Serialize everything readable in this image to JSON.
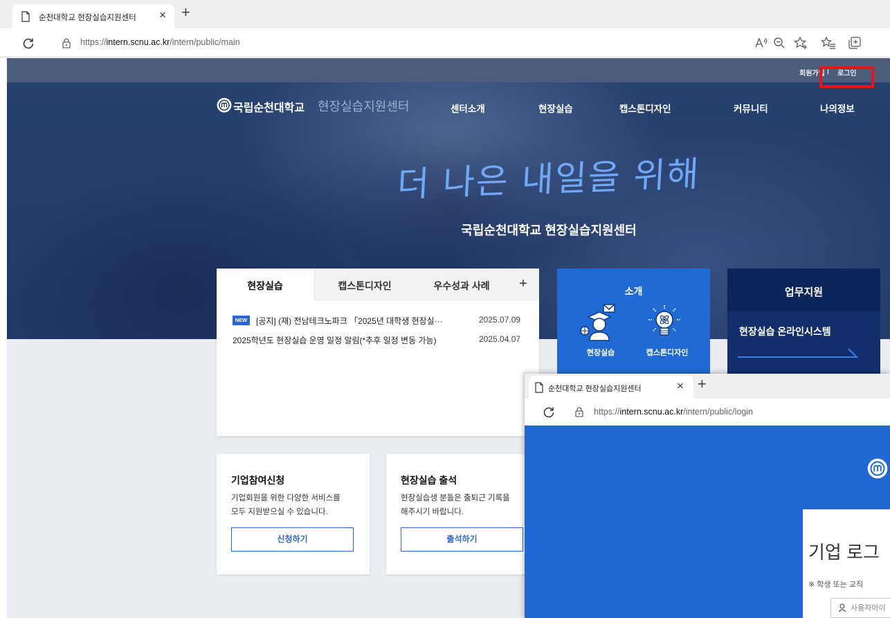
{
  "browser": {
    "tab": {
      "title": "순천대학교 현장실습지원센터",
      "close": "×"
    },
    "new_tab": "+",
    "url": {
      "scheme": "https://",
      "host": "intern.scnu.ac.kr",
      "path": "/intern/public/main"
    },
    "toolbar_icons": [
      "read-aloud-icon",
      "zoom-icon",
      "add-favorite-icon",
      "favorites-icon",
      "collections-icon"
    ]
  },
  "topbar": {
    "signup": "회원가입",
    "separator": "|",
    "login": "로그인"
  },
  "header": {
    "logo_name": "국립순천대학교",
    "logo_sub": "현장실습지원센터",
    "menu": [
      "센터소개",
      "현장실습",
      "캡스톤디자인",
      "커뮤니티",
      "나의정보"
    ]
  },
  "hero": {
    "headline": "더 나은 내일을 위해",
    "subtitle": "국립순천대학교 현장실습지원센터"
  },
  "notice": {
    "tabs": [
      "현장실습",
      "캡스톤디자인",
      "우수성과 사례"
    ],
    "active_tab_index": 0,
    "more": "+",
    "items": [
      {
        "badge": "NEW",
        "title": "[공지] (재) 전남테크노파크 「2025년 대학생 현장실···",
        "date": "2025.07.09"
      },
      {
        "title": "2025학년도 현장실습 운영 일정 알림(*추후 일정 변동 가능)",
        "date": "2025.04.07"
      }
    ]
  },
  "intro": {
    "title": "소개",
    "items": [
      {
        "label": "현장실습",
        "icon": "student-icon"
      },
      {
        "label": "캡스톤디자인",
        "icon": "lightbulb-icon"
      }
    ]
  },
  "support": {
    "title": "업무지원",
    "link": "현장실습 온라인시스템"
  },
  "services": [
    {
      "title": "기업참여신청",
      "desc": [
        "기업회원을 위한 다양한 서비스를",
        "모두 지원받으실 수 있습니다."
      ],
      "button": "신청하기"
    },
    {
      "title": "현장실습 출석",
      "desc": [
        "현장실습생 분들은 출퇴근 기록을",
        "해주시기 바랍니다."
      ],
      "button": "출석하기"
    }
  ],
  "login_window": {
    "tab_title": "순천대학교 현장실습지원센터",
    "close": "×",
    "new_tab": "+",
    "url": {
      "scheme": "https://",
      "host": "intern.scnu.ac.kr",
      "path": "/intern/public/login"
    },
    "heading": "기업 로그",
    "note": "※ 학생 또는 교직",
    "username_placeholder": "사용자아이"
  },
  "colors": {
    "accent_blue": "#1f6ad4",
    "navy": "#0b2459",
    "topbar": "#4b5d7b",
    "highlight": "#e8141b"
  }
}
